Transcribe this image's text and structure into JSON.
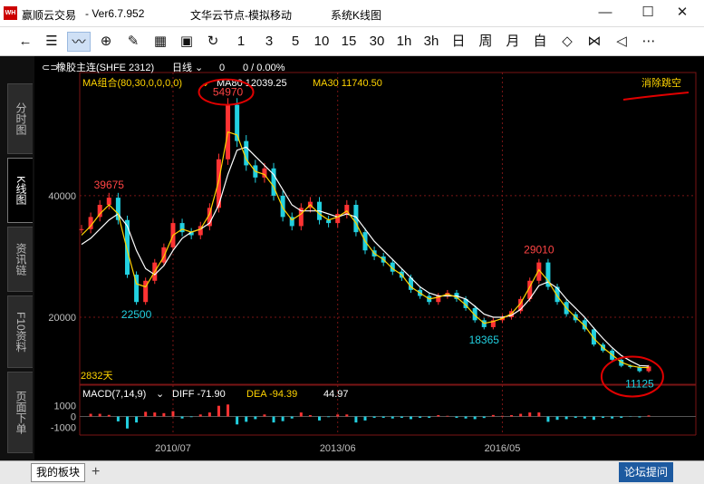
{
  "titlebar": {
    "logo": "WH",
    "app_name": "赢顺云交易",
    "app_version": "-  Ver6.7.952",
    "window_title": "文华云节点-模拟移动",
    "window_subtitle": "系统K线图",
    "minimize": "—",
    "maximize": "☐",
    "close": "✕"
  },
  "toolbar": {
    "back": "←",
    "list": "☰",
    "line": "〰",
    "candle": "⊕",
    "draw": "✎",
    "report": "▦",
    "save": "▣",
    "refresh": "↻",
    "periods": [
      "1",
      "3",
      "5",
      "10",
      "15",
      "30",
      "1h",
      "3h",
      "日",
      "周",
      "月",
      "自"
    ],
    "zoom": "◇",
    "cross": "⋈",
    "prev": "◁",
    "more": "⋯"
  },
  "leftnav": {
    "tabs": [
      "分时图",
      "K线图",
      "资讯链",
      "F10资料",
      "页面下单"
    ]
  },
  "chart_header": {
    "contract_icon": "⊂⊃",
    "contract": "橡胶主连(SHFE 2312)",
    "period": "日线",
    "period_arrow": "⌄",
    "change": "0",
    "change_pct": "0 / 0.00%",
    "ma_label": "MA组合(80,30,0,0,0,0)",
    "ma_arrow": "⌄",
    "ma80": "MA80 12039.25",
    "ma30": "MA30 11740.50",
    "clear_gaps": "消除跳空",
    "days": "2832天"
  },
  "macd_header": {
    "label": "MACD(7,14,9)",
    "arrow": "⌄",
    "diff": "DIFF -71.90",
    "dea": "DEA -94.39",
    "macd": "44.97"
  },
  "bottombar": {
    "tab": "我的板块",
    "add": "+",
    "forum": "论坛提问"
  },
  "colors": {
    "price_up": "#ff3333",
    "price_down": "#22d0e0",
    "ma80": "#ffffff",
    "ma30": "#ffd400",
    "grid": "#7a1515",
    "axis_text": "#c0c0c0",
    "high_label": "#ff4444",
    "low_label": "#22d0e0",
    "annotation": "#e00000"
  },
  "chart_data": [
    {
      "type": "line",
      "title": "橡胶主连(SHFE 2312) 日线",
      "x": [
        "2008/12",
        "2009/02",
        "2009/04",
        "2009/06",
        "2009/08",
        "2009/10",
        "2009/12",
        "2010/02",
        "2010/04",
        "2010/06",
        "2010/07",
        "2010/09",
        "2010/11",
        "2011/01",
        "2011/02",
        "2011/04",
        "2011/06",
        "2011/08",
        "2011/10",
        "2011/12",
        "2012/02",
        "2012/04",
        "2012/06",
        "2012/08",
        "2012/10",
        "2012/12",
        "2013/02",
        "2013/04",
        "2013/06",
        "2013/08",
        "2013/10",
        "2013/12",
        "2014/02",
        "2014/04",
        "2014/06",
        "2014/08",
        "2014/10",
        "2014/12",
        "2015/02",
        "2015/04",
        "2015/06",
        "2015/08",
        "2015/10",
        "2015/12",
        "2016/02",
        "2016/04",
        "2016/05",
        "2016/07",
        "2016/09",
        "2016/11",
        "2017/01",
        "2017/03",
        "2017/05",
        "2017/07",
        "2017/09",
        "2017/11",
        "2018/01",
        "2018/03",
        "2018/05",
        "2018/07",
        "2018/09",
        "2018/11",
        "2019/01"
      ],
      "series": [
        {
          "name": "price",
          "values": [
            34500,
            36500,
            38500,
            39675,
            36000,
            27000,
            22500,
            26000,
            29000,
            31500,
            35500,
            34000,
            33500,
            35000,
            38000,
            46000,
            54970,
            49000,
            45000,
            43000,
            44500,
            40000,
            36500,
            35000,
            38000,
            39000,
            36000,
            35500,
            37000,
            38500,
            34000,
            31000,
            30000,
            29000,
            27500,
            26500,
            24500,
            23500,
            22500,
            23500,
            24000,
            23000,
            21500,
            19500,
            18365,
            19500,
            20000,
            21000,
            23000,
            26000,
            29010,
            25000,
            22500,
            20500,
            19500,
            18000,
            15500,
            14500,
            13000,
            12000,
            11800,
            11125,
            11900
          ]
        },
        {
          "name": "MA30",
          "values": [
            33500,
            35000,
            37000,
            38500,
            37000,
            31000,
            25500,
            25000,
            27500,
            30000,
            33500,
            34500,
            34000,
            34500,
            37000,
            42500,
            50500,
            50000,
            46000,
            44000,
            43500,
            41500,
            38000,
            36000,
            37000,
            38500,
            37000,
            36000,
            36500,
            37500,
            35500,
            32500,
            30500,
            29500,
            28000,
            27000,
            25000,
            24000,
            23000,
            23300,
            23800,
            23300,
            22000,
            20300,
            19000,
            19300,
            19800,
            20600,
            22300,
            25000,
            27800,
            26000,
            23500,
            21500,
            20000,
            18600,
            16500,
            15000,
            13800,
            12600,
            12000,
            11741,
            11700
          ]
        },
        {
          "name": "MA80",
          "values": [
            32000,
            33000,
            34500,
            36000,
            37000,
            35000,
            31000,
            28000,
            27000,
            28500,
            31000,
            33000,
            34000,
            34500,
            35500,
            38500,
            43500,
            47500,
            48000,
            46500,
            45000,
            43500,
            41000,
            38500,
            37500,
            37500,
            37500,
            37000,
            36500,
            37000,
            36500,
            34500,
            32500,
            31000,
            29500,
            28000,
            26500,
            25000,
            24000,
            23500,
            23500,
            23500,
            23000,
            21800,
            20500,
            20000,
            20000,
            20300,
            21300,
            23000,
            25200,
            25800,
            24800,
            23000,
            21500,
            20000,
            18200,
            16500,
            15000,
            13700,
            12800,
            12039,
            11950
          ]
        }
      ],
      "yticks": [
        20000,
        40000
      ],
      "ylim": [
        10000,
        57000
      ],
      "xticks": [
        "2010/07",
        "2013/06",
        "2016/05"
      ],
      "annotations": [
        {
          "label": "54970",
          "x": "2011/06",
          "y": 54970,
          "kind": "high"
        },
        {
          "label": "39675",
          "x": "2009/06",
          "y": 39675,
          "kind": "high"
        },
        {
          "label": "22500",
          "x": "2009/12",
          "y": 22500,
          "kind": "low"
        },
        {
          "label": "29010",
          "x": "2017/01",
          "y": 29010,
          "kind": "high"
        },
        {
          "label": "18365",
          "x": "2016/02",
          "y": 18365,
          "kind": "low"
        },
        {
          "label": "11125",
          "x": "2018/11",
          "y": 11125,
          "kind": "low"
        }
      ]
    },
    {
      "type": "bar",
      "title": "MACD(7,14,9)",
      "yticks": [
        1000,
        0,
        -1000
      ],
      "ylim": [
        -1400,
        1400
      ]
    }
  ]
}
